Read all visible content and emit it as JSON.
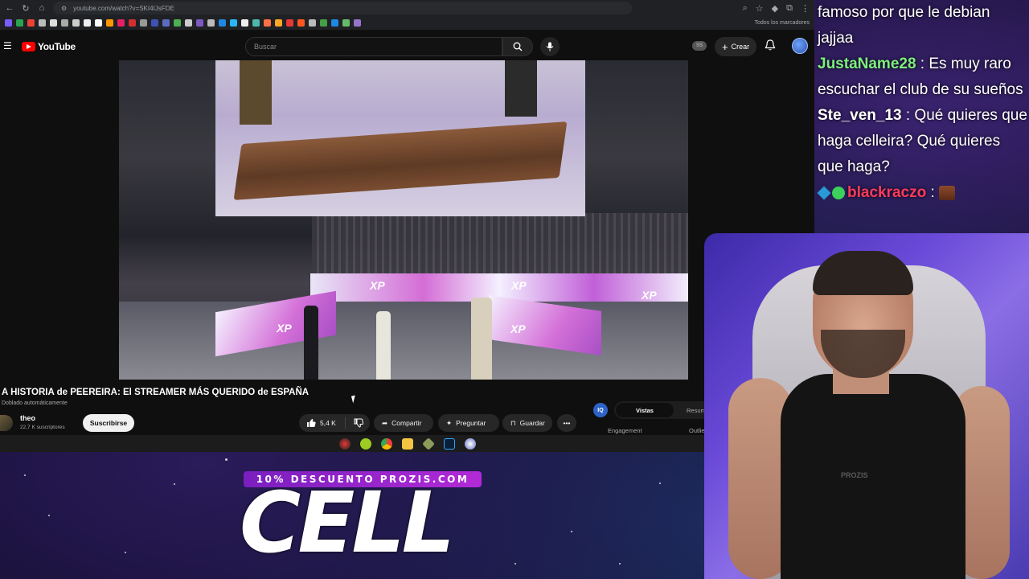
{
  "browser": {
    "url": "youtube.com/watch?v=SKI4IJsFDE",
    "bookmarks_all": "Todos los marcadores"
  },
  "youtube": {
    "logo": "YouTube",
    "search_placeholder": "Buscar",
    "ss_badge": "SS",
    "create_label": "Crear"
  },
  "video": {
    "title": "A HISTORIA de PEEREIRA: El STREAMER MÁS QUERIDO de ESPAÑA",
    "dubbed_label": "Doblado automáticamente",
    "xp_labels": [
      "XP",
      "XP",
      "XP",
      "XP",
      "XP"
    ]
  },
  "channel": {
    "name": "theo",
    "subscribers": "22,7 K suscriptores",
    "subscribe_label": "Suscribirse"
  },
  "actions": {
    "likes": "5,4 K",
    "share": "Compartir",
    "ask": "Preguntar",
    "save": "Guardar"
  },
  "side_panel": {
    "icon_label": "IQ",
    "tab_active": "Vistas",
    "tab_other": "Resum",
    "engagement": "Engagement",
    "outlier": "Outlie"
  },
  "chat": [
    {
      "user": "",
      "user_color": "#ffffff",
      "text": "famoso por que le debian jajjaa"
    },
    {
      "user": "JustaName28",
      "user_color": "#7cf07c",
      "text": "Es muy raro escuchar el club de su sueños"
    },
    {
      "user": "Ste_ven_13",
      "user_color": "#ffffff",
      "text": "Qué quieres que haga celleira? Qué quieres que haga?"
    },
    {
      "user": "blackraczo",
      "user_color": "#ff3b5c",
      "text": ""
    }
  ],
  "webcam": {
    "shirt_brand": "PROZIS"
  },
  "promo": {
    "banner": "10% DESCUENTO PROZIS.COM",
    "big_text": "CELL"
  }
}
